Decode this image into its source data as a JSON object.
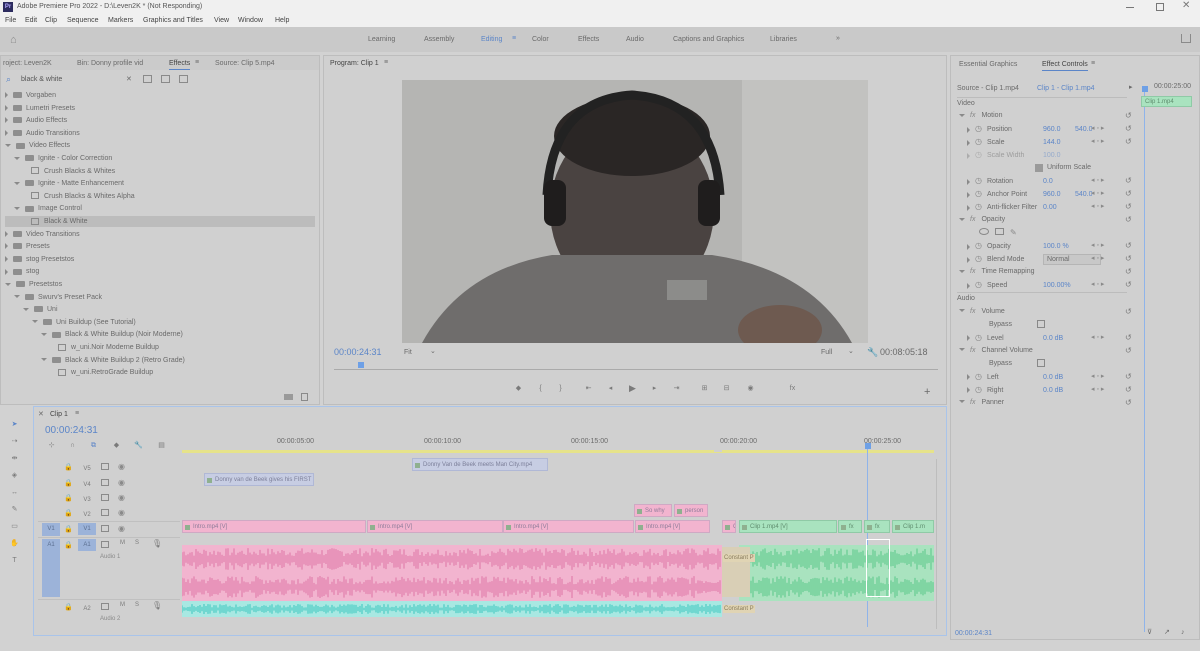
{
  "window": {
    "title": "Adobe Premiere Pro 2022 - D:\\Leven2K * (Not Responding)",
    "app_icon": "Pr"
  },
  "menu": [
    "File",
    "Edit",
    "Clip",
    "Sequence",
    "Markers",
    "Graphics and Titles",
    "View",
    "Window",
    "Help"
  ],
  "workspaces": [
    "Learning",
    "Assembly",
    "Editing",
    "Color",
    "Effects",
    "Audio",
    "Captions and Graphics",
    "Libraries"
  ],
  "active_workspace": "Editing",
  "left_panel": {
    "tabs": [
      "roject: Leven2K",
      "Bin: Donny profile vid",
      "Effects",
      "Source: Clip 5.mp4"
    ],
    "active_tab": "Effects",
    "search_value": "black & white",
    "tree": [
      {
        "label": "Vorgaben",
        "level": 0,
        "type": "folder"
      },
      {
        "label": "Lumetri Presets",
        "level": 0,
        "type": "folder"
      },
      {
        "label": "Audio Effects",
        "level": 0,
        "type": "folder"
      },
      {
        "label": "Audio Transitions",
        "level": 0,
        "type": "folder"
      },
      {
        "label": "Video Effects",
        "level": 0,
        "type": "folder"
      },
      {
        "label": "Ignite - Color Correction",
        "level": 1,
        "type": "folder"
      },
      {
        "label": "Crush Blacks & Whites",
        "level": 2,
        "type": "effect"
      },
      {
        "label": "Ignite - Matte Enhancement",
        "level": 1,
        "type": "folder"
      },
      {
        "label": "Crush Blacks & Whites Alpha",
        "level": 2,
        "type": "effect"
      },
      {
        "label": "Image Control",
        "level": 1,
        "type": "folder"
      },
      {
        "label": "Black & White",
        "level": 2,
        "type": "effect",
        "selected": true
      },
      {
        "label": "Video Transitions",
        "level": 0,
        "type": "folder"
      },
      {
        "label": "Presets",
        "level": 0,
        "type": "folder"
      },
      {
        "label": "stog Presetstos",
        "level": 0,
        "type": "folder"
      },
      {
        "label": "stog",
        "level": 0,
        "type": "folder"
      },
      {
        "label": "Presetstos",
        "level": 0,
        "type": "folder"
      },
      {
        "label": "Swurv's Preset Pack",
        "level": 1,
        "type": "folder"
      },
      {
        "label": "Uni",
        "level": 2,
        "type": "folder"
      },
      {
        "label": "Uni Buildup (See Tutorial)",
        "level": 3,
        "type": "folder"
      },
      {
        "label": "Black & White Buildup (Noir Moderne)",
        "level": 4,
        "type": "folder"
      },
      {
        "label": "w_uni.Noir Moderne Buildup",
        "level": 5,
        "type": "effect"
      },
      {
        "label": "Black & White Buildup 2 (Retro Grade)",
        "level": 4,
        "type": "folder"
      },
      {
        "label": "w_uni.RetroGrade Buildup",
        "level": 5,
        "type": "effect"
      }
    ]
  },
  "program": {
    "title": "Program: Clip 1",
    "timecode": "00:00:24:31",
    "fit": "Fit",
    "quality": "Full",
    "duration": "00:08:05:18"
  },
  "right_panel": {
    "tabs": [
      "Essential Graphics",
      "Effect Controls"
    ],
    "active_tab": "Effect Controls",
    "source": "Source - Clip 1.mp4",
    "clip": "Clip 1 - Clip 1.mp4",
    "mini_timecode": "00:00:25:00",
    "mini_clip": "Clip 1.mp4",
    "rows": [
      {
        "kind": "section",
        "label": "Video"
      },
      {
        "kind": "fx",
        "label": "Motion"
      },
      {
        "kind": "prop",
        "label": "Position",
        "v1": "960.0",
        "v2": "540.0"
      },
      {
        "kind": "prop",
        "label": "Scale",
        "v1": "144.0"
      },
      {
        "kind": "prop",
        "label": "Scale Width",
        "v1": "100.0",
        "dim": true
      },
      {
        "kind": "check",
        "label": "Uniform Scale"
      },
      {
        "kind": "prop",
        "label": "Rotation",
        "v1": "0.0"
      },
      {
        "kind": "prop",
        "label": "Anchor Point",
        "v1": "960.0",
        "v2": "540.0"
      },
      {
        "kind": "prop",
        "label": "Anti-flicker Filter",
        "v1": "0.00"
      },
      {
        "kind": "fx",
        "label": "Opacity"
      },
      {
        "kind": "masks"
      },
      {
        "kind": "prop",
        "label": "Opacity",
        "v1": "100.0 %"
      },
      {
        "kind": "select",
        "label": "Blend Mode",
        "v1": "Normal"
      },
      {
        "kind": "fx",
        "label": "Time Remapping"
      },
      {
        "kind": "prop",
        "label": "Speed",
        "v1": "100.00%"
      },
      {
        "kind": "section",
        "label": "Audio"
      },
      {
        "kind": "fx",
        "label": "Volume"
      },
      {
        "kind": "check",
        "label": "Bypass"
      },
      {
        "kind": "prop",
        "label": "Level",
        "v1": "0.0 dB"
      },
      {
        "kind": "fx",
        "label": "Channel Volume"
      },
      {
        "kind": "check",
        "label": "Bypass"
      },
      {
        "kind": "prop",
        "label": "Left",
        "v1": "0.0 dB"
      },
      {
        "kind": "prop",
        "label": "Right",
        "v1": "0.0 dB"
      },
      {
        "kind": "fx",
        "label": "Panner"
      }
    ],
    "footer_timecode": "00:00:24:31"
  },
  "timeline": {
    "tab": "Clip 1",
    "timecode": "00:00:24:31",
    "ruler": [
      "00:00:05:00",
      "00:00:10:00",
      "00:00:15:00",
      "00:00:20:00",
      "00:00:25:00"
    ],
    "tracks": [
      {
        "name": "V5"
      },
      {
        "name": "V4"
      },
      {
        "name": "V3"
      },
      {
        "name": "V2"
      },
      {
        "name": "V1",
        "src": "V1"
      },
      {
        "name": "A1",
        "src": "A1",
        "label": "Audio 1"
      },
      {
        "name": "A2",
        "label": "Audio 2"
      }
    ],
    "clips": {
      "v5": [
        "Donny Van de Beek meets Man City.mp4"
      ],
      "v4": [
        "Donny van de Beek gives his FIRST"
      ],
      "v2": [
        "So why",
        "person"
      ],
      "v1": [
        "Intro.mp4 [V]",
        "Intro.mp4 [V]",
        "Intro.mp4 [V]",
        "Intro.mp4 [V]",
        "Cons",
        "Clip 1.mp4 [V]",
        "fx",
        "fx",
        "Clip 1.m"
      ],
      "a_labels": [
        "Constant P",
        "Constant P"
      ]
    }
  },
  "colors": {
    "accent": "#5b85c8",
    "pink": "#f2b4cf",
    "green": "#a9e3bf",
    "playhead": "#6ea0e6"
  }
}
